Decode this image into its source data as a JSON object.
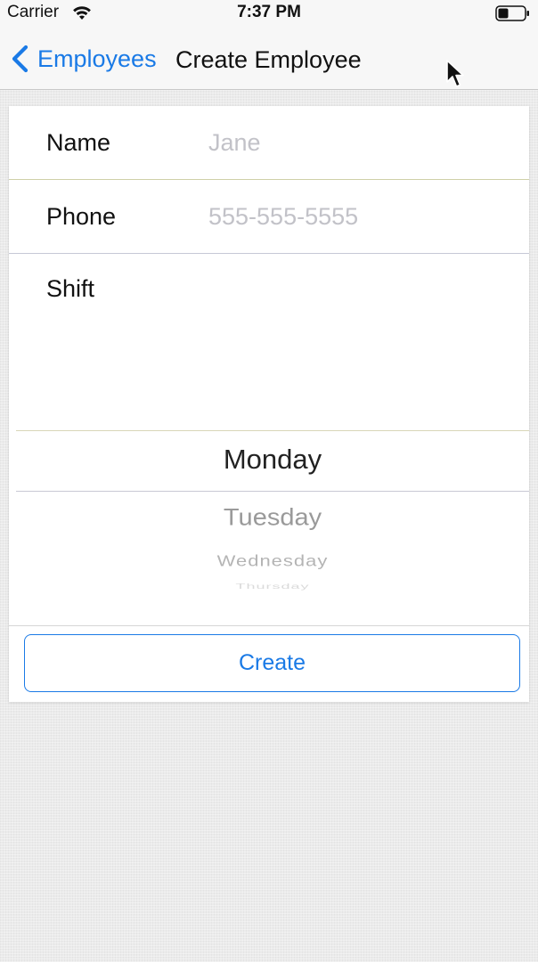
{
  "status_bar": {
    "carrier": "Carrier",
    "time": "7:37 PM",
    "wifi_icon": "wifi-icon",
    "battery_icon": "battery-icon"
  },
  "nav": {
    "back_label": "Employees",
    "back_icon": "chevron-left-icon",
    "title": "Create Employee"
  },
  "form": {
    "name_label": "Name",
    "name_placeholder": "Jane",
    "name_value": "",
    "phone_label": "Phone",
    "phone_placeholder": "555-555-5555",
    "phone_value": "",
    "shift_label": "Shift"
  },
  "picker": {
    "selected": "Monday",
    "following": [
      "Tuesday",
      "Wednesday",
      "Thursday"
    ]
  },
  "actions": {
    "create_label": "Create"
  },
  "colors": {
    "accent": "#1a7ae6",
    "background": "#ebebeb",
    "card": "#ffffff",
    "placeholder": "#c2c2c8"
  }
}
